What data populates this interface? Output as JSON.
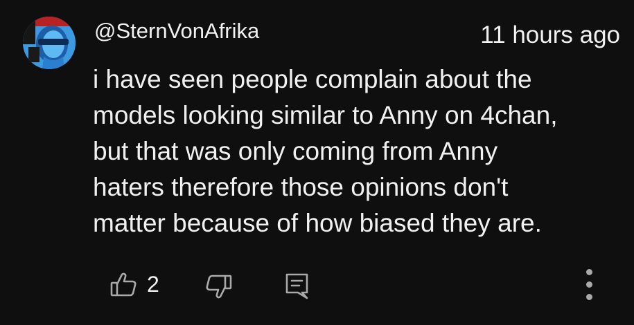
{
  "comment": {
    "author": "@SternVonAfrika",
    "timestamp": "11 hours ago",
    "text_lines": [
      "i have seen people complain about the",
      "models looking similar to Anny on 4chan,",
      "but that was only coming from Anny",
      "haters therefore those opinions don't",
      "matter because of how biased they are."
    ],
    "like_count": "2"
  },
  "icons": {
    "avatar": "user-avatar",
    "like": "thumbs-up-icon",
    "dislike": "thumbs-down-icon",
    "reply": "comment-reply-icon",
    "more": "more-vertical-icon"
  },
  "colors": {
    "background": "#0f0f0f",
    "text": "#f1f1f1",
    "icon": "#aaaaaa",
    "avatar_accent": "#2e90d8"
  }
}
